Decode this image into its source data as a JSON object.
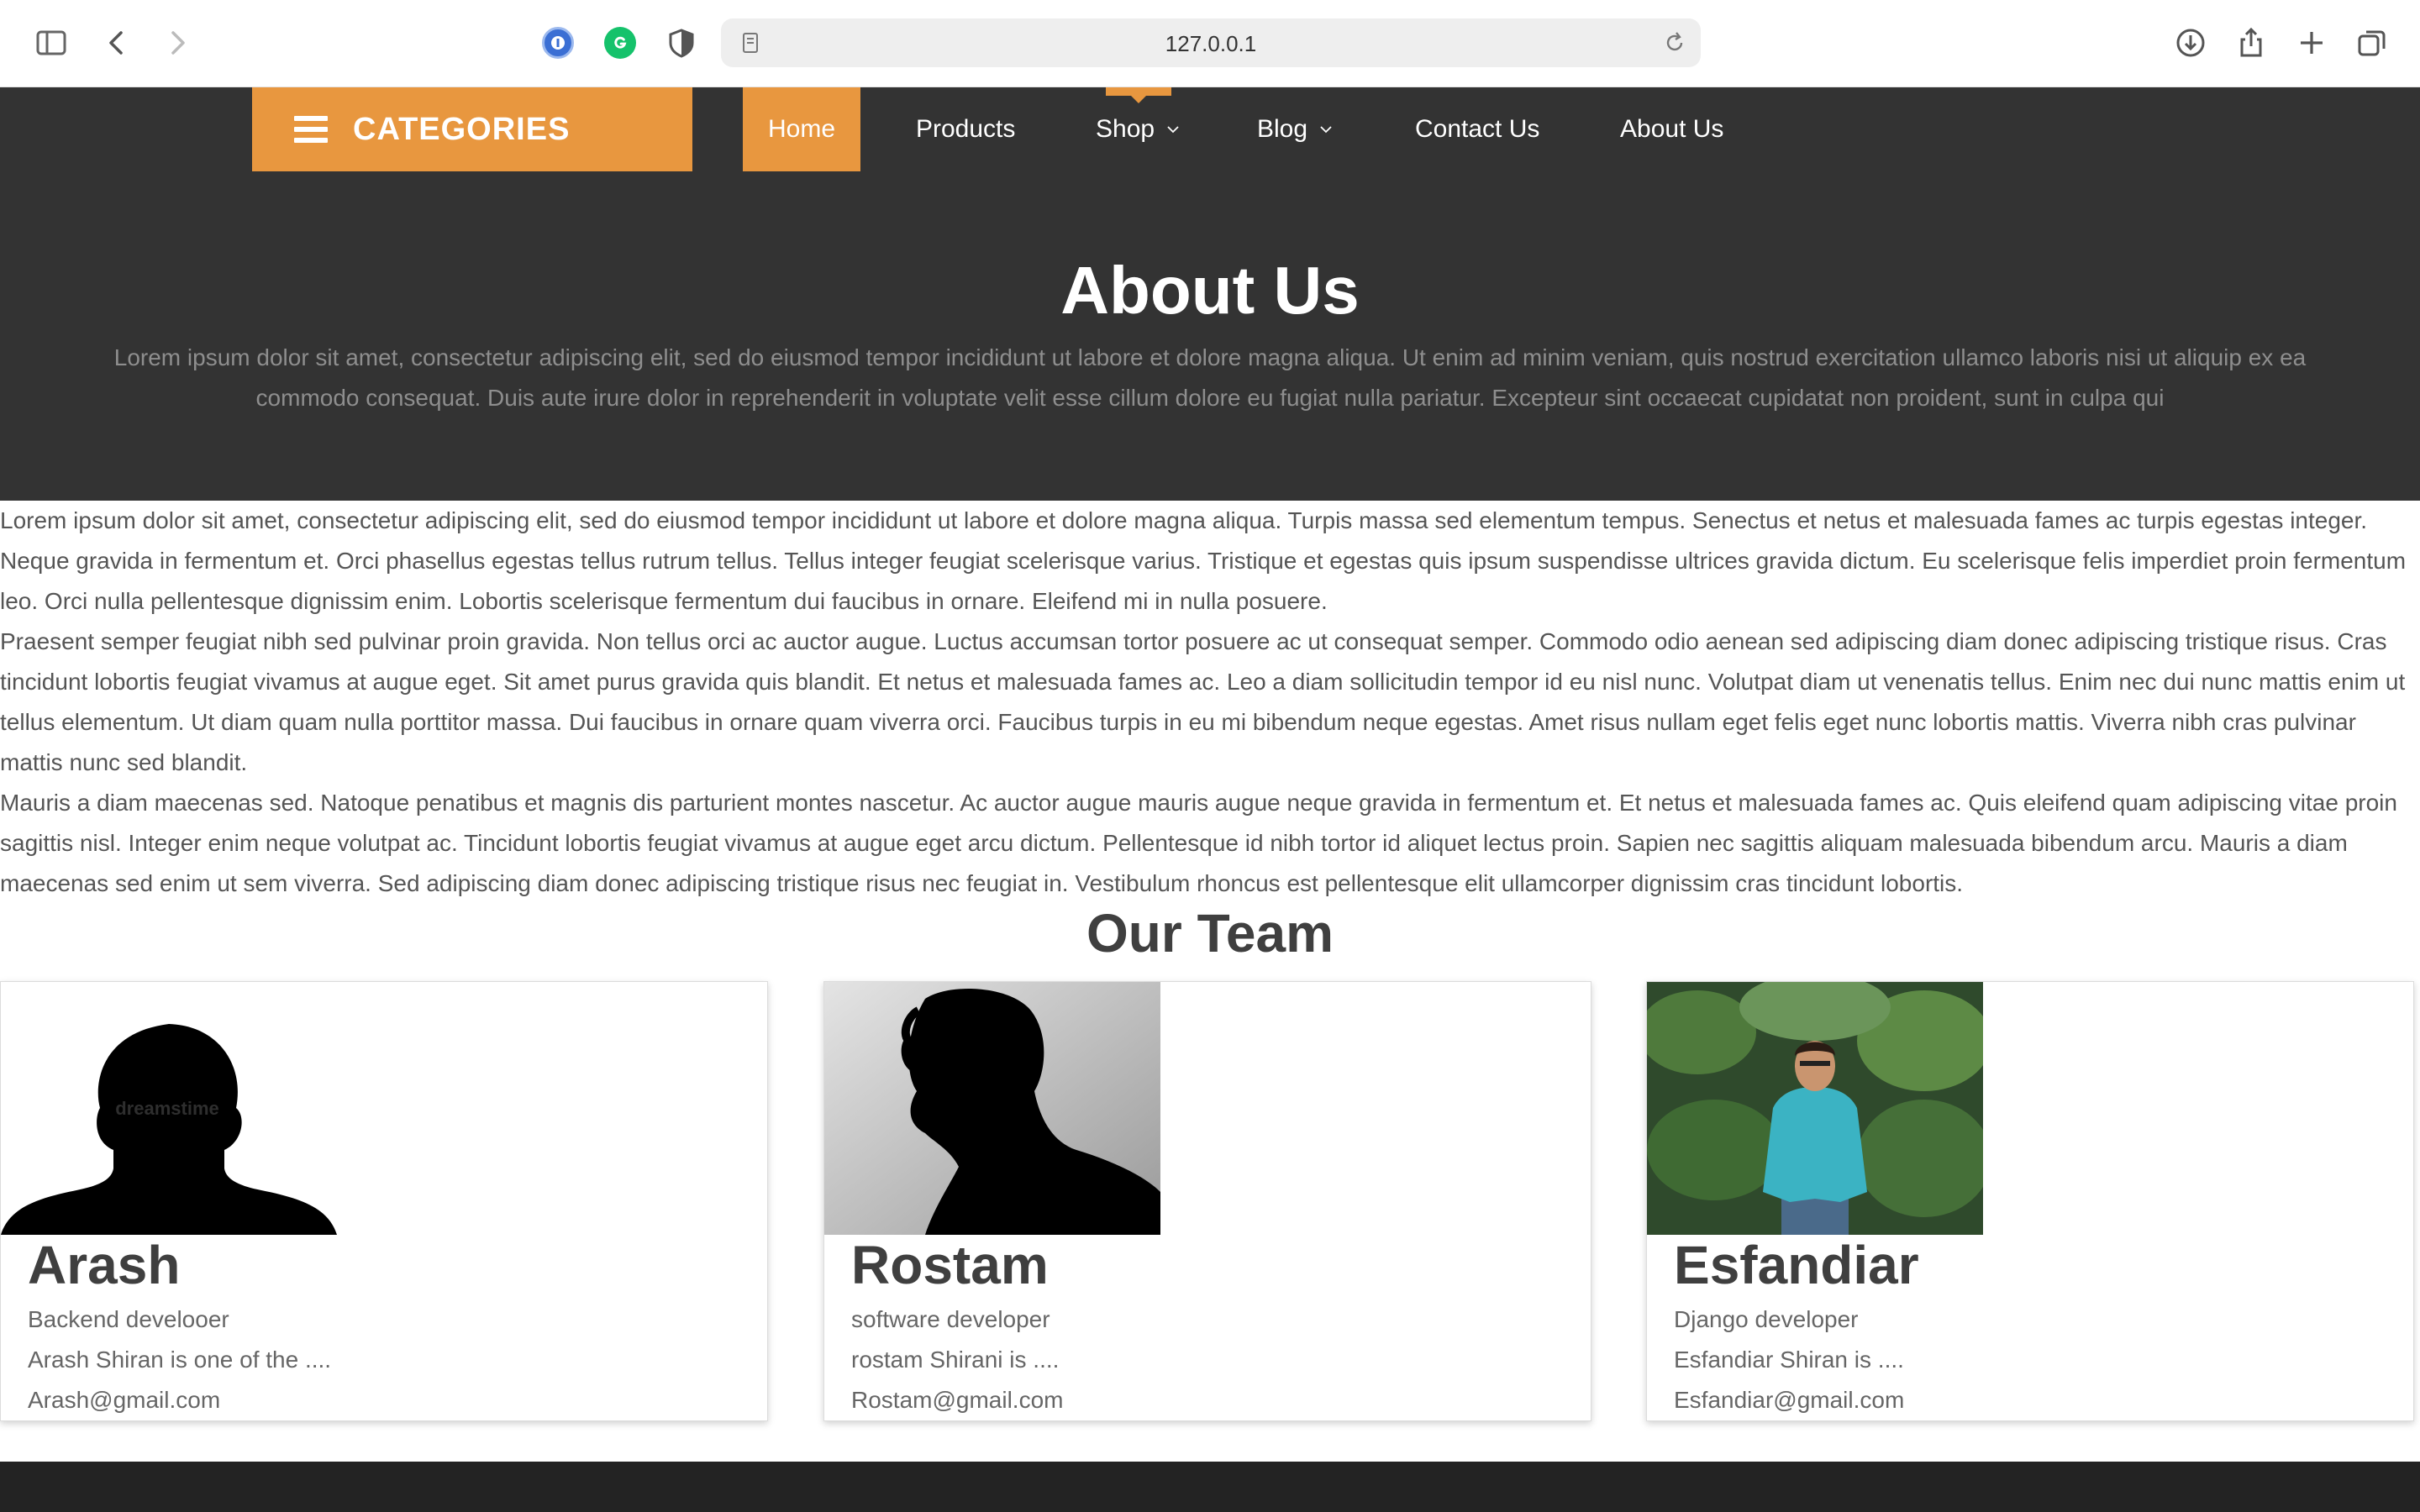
{
  "browser": {
    "url": "127.0.0.1",
    "icons": [
      "sidebar-icon",
      "back-icon",
      "forward-icon",
      "password-extension-icon",
      "grammarly-icon",
      "privacy-shield-icon",
      "page-icon",
      "reload-icon",
      "download-icon",
      "share-icon",
      "new-tab-icon",
      "tab-overview-icon"
    ]
  },
  "header": {
    "categories_label": "CATEGORIES",
    "nav": {
      "home": "Home",
      "products": "Products",
      "shop": "Shop",
      "blog": "Blog",
      "contact": "Contact Us",
      "about": "About Us"
    },
    "accent_color": "#e8973f",
    "background_color": "#333333"
  },
  "hero": {
    "title": "About Us",
    "subtitle": "Lorem ipsum dolor sit amet, consectetur adipiscing elit, sed do eiusmod tempor incididunt ut labore et dolore magna aliqua. Ut enim ad minim veniam, quis nostrud exercitation ullamco laboris nisi ut aliquip ex ea commodo consequat. Duis aute irure dolor in reprehenderit in voluptate velit esse cillum dolore eu fugiat nulla pariatur. Excepteur sint occaecat cupidatat non proident, sunt in culpa qui"
  },
  "content": {
    "paragraphs": [
      "Lorem ipsum dolor sit amet, consectetur adipiscing elit, sed do eiusmod tempor incididunt ut labore et dolore magna aliqua. Turpis massa sed elementum tempus. Senectus et netus et malesuada fames ac turpis egestas integer. Neque gravida in fermentum et. Orci phasellus egestas tellus rutrum tellus. Tellus integer feugiat scelerisque varius. Tristique et egestas quis ipsum suspendisse ultrices gravida dictum. Eu scelerisque felis imperdiet proin fermentum leo. Orci nulla pellentesque dignissim enim. Lobortis scelerisque fermentum dui faucibus in ornare. Eleifend mi in nulla posuere.",
      "Praesent semper feugiat nibh sed pulvinar proin gravida. Non tellus orci ac auctor augue. Luctus accumsan tortor posuere ac ut consequat semper. Commodo odio aenean sed adipiscing diam donec adipiscing tristique risus. Cras tincidunt lobortis feugiat vivamus at augue eget. Sit amet purus gravida quis blandit. Et netus et malesuada fames ac. Leo a diam sollicitudin tempor id eu nisl nunc. Volutpat diam ut venenatis tellus. Enim nec dui nunc mattis enim ut tellus elementum. Ut diam quam nulla porttitor massa. Dui faucibus in ornare quam viverra orci. Faucibus turpis in eu mi bibendum neque egestas. Amet risus nullam eget felis eget nunc lobortis mattis. Viverra nibh cras pulvinar mattis nunc sed blandit.",
      "Mauris a diam maecenas sed. Natoque penatibus et magnis dis parturient montes nascetur. Ac auctor augue mauris augue neque gravida in fermentum et. Et netus et malesuada fames ac. Quis eleifend quam adipiscing vitae proin sagittis nisl. Integer enim neque volutpat ac. Tincidunt lobortis feugiat vivamus at augue eget arcu dictum. Pellentesque id nibh tortor id aliquet lectus proin. Sapien nec sagittis aliquam malesuada bibendum arcu. Mauris a diam maecenas sed enim ut sem viverra. Sed adipiscing diam donec adipiscing tristique risus nec feugiat in. Vestibulum rhoncus est pellentesque elit ullamcorper dignissim cras tincidunt lobortis."
    ]
  },
  "team": {
    "title": "Our Team",
    "members": [
      {
        "name": "Arash",
        "role": "Backend develooer",
        "bio": "Arash Shiran is one of the ....",
        "email": "Arash@gmail.com",
        "photo_watermark": "dreamstime"
      },
      {
        "name": "Rostam",
        "role": "software developer",
        "bio": "rostam Shirani is ....",
        "email": "Rostam@gmail.com"
      },
      {
        "name": "Esfandiar",
        "role": "Django developer",
        "bio": "Esfandiar Shiran is ....",
        "email": "Esfandiar@gmail.com"
      }
    ]
  }
}
